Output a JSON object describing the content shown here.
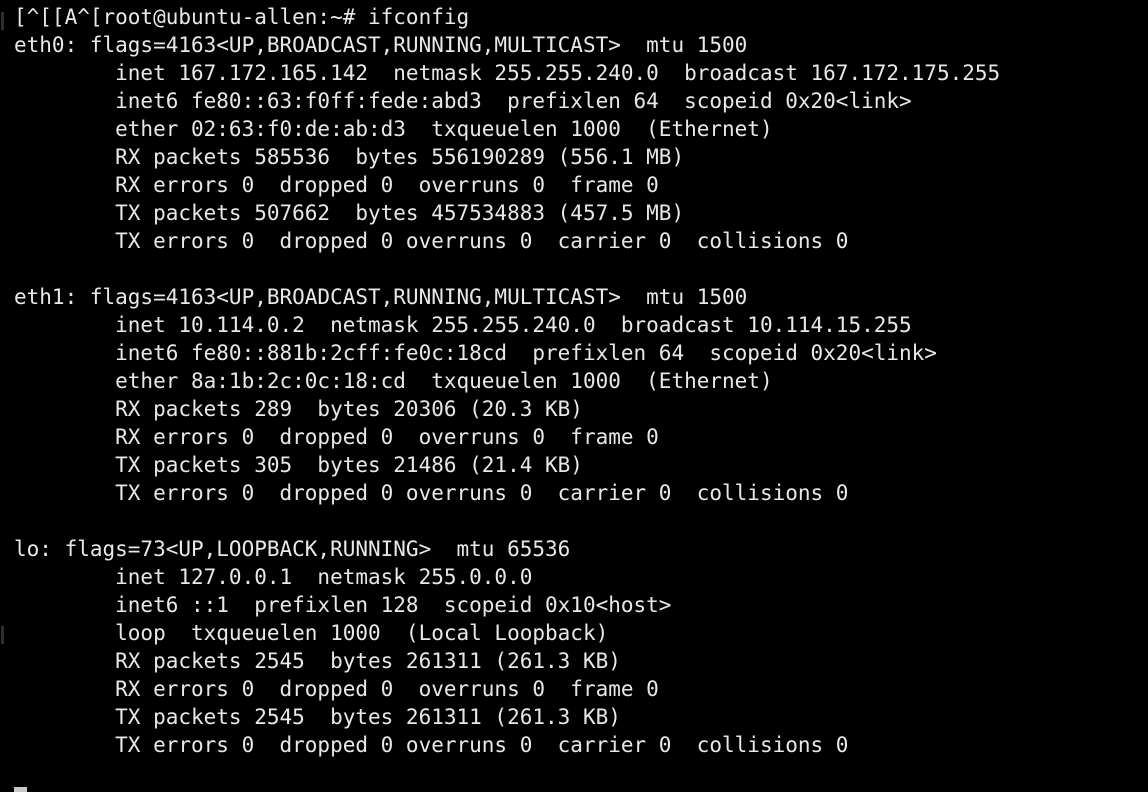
{
  "terminal": {
    "lines": [
      "[^[[A^[root@ubuntu-allen:~# ifconfig",
      "eth0: flags=4163<UP,BROADCAST,RUNNING,MULTICAST>  mtu 1500",
      "        inet 167.172.165.142  netmask 255.255.240.0  broadcast 167.172.175.255",
      "        inet6 fe80::63:f0ff:fede:abd3  prefixlen 64  scopeid 0x20<link>",
      "        ether 02:63:f0:de:ab:d3  txqueuelen 1000  (Ethernet)",
      "        RX packets 585536  bytes 556190289 (556.1 MB)",
      "        RX errors 0  dropped 0  overruns 0  frame 0",
      "        TX packets 507662  bytes 457534883 (457.5 MB)",
      "        TX errors 0  dropped 0 overruns 0  carrier 0  collisions 0",
      "",
      "eth1: flags=4163<UP,BROADCAST,RUNNING,MULTICAST>  mtu 1500",
      "        inet 10.114.0.2  netmask 255.255.240.0  broadcast 10.114.15.255",
      "        inet6 fe80::881b:2cff:fe0c:18cd  prefixlen 64  scopeid 0x20<link>",
      "        ether 8a:1b:2c:0c:18:cd  txqueuelen 1000  (Ethernet)",
      "        RX packets 289  bytes 20306 (20.3 KB)",
      "        RX errors 0  dropped 0  overruns 0  frame 0",
      "        TX packets 305  bytes 21486 (21.4 KB)",
      "        TX errors 0  dropped 0 overruns 0  carrier 0  collisions 0",
      "",
      "lo: flags=73<UP,LOOPBACK,RUNNING>  mtu 65536",
      "        inet 127.0.0.1  netmask 255.0.0.0",
      "        inet6 ::1  prefixlen 128  scopeid 0x10<host>",
      "        loop  txqueuelen 1000  (Local Loopback)",
      "        RX packets 2545  bytes 261311 (261.3 KB)",
      "        RX errors 0  dropped 0  overruns 0  frame 0",
      "        TX packets 2545  bytes 261311 (261.3 KB)",
      "        TX errors 0  dropped 0 overruns 0  carrier 0  collisions 0",
      ""
    ],
    "prompt_partial": "",
    "colors": {
      "background": "#000000",
      "foreground": "#e8e8e8",
      "cursor": "#c8c8c8"
    }
  }
}
